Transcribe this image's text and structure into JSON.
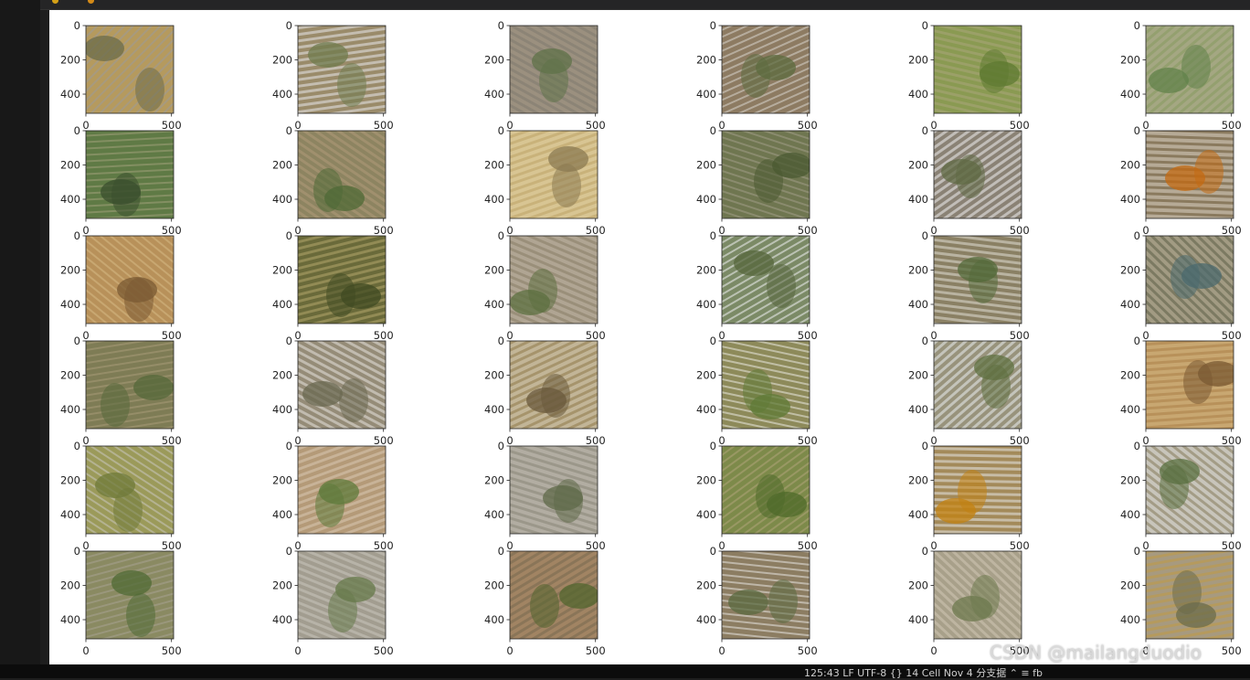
{
  "figure": {
    "rows": 6,
    "cols": 6,
    "tick_labels": {
      "y": [
        "0",
        "200",
        "400"
      ],
      "x": [
        "0",
        "500"
      ]
    },
    "panels": [
      {
        "theme": "house-yellow",
        "base": "#b59a5e",
        "accent": "#6b6b4a",
        "extra": "#9a9a9a"
      },
      {
        "theme": "rows-white",
        "base": "#9a8b6a",
        "accent": "#6f7b4e",
        "extra": "#e8e8ea"
      },
      {
        "theme": "mixed-field",
        "base": "#8c8476",
        "accent": "#5f7248",
        "extra": "#a79b86"
      },
      {
        "theme": "rows-brown",
        "base": "#8d7b62",
        "accent": "#5c6b3f",
        "extra": "#d9d5cd"
      },
      {
        "theme": "green-bush",
        "base": "#8a9a52",
        "accent": "#5e7a32",
        "extra": "#a9a67a"
      },
      {
        "theme": "green-field",
        "base": "#94a06f",
        "accent": "#61824a",
        "extra": "#b1ad92"
      },
      {
        "theme": "ravine",
        "base": "#5f7a45",
        "accent": "#3a4f2d",
        "extra": "#a0a07a"
      },
      {
        "theme": "terraces",
        "base": "#8d8461",
        "accent": "#4f6a36",
        "extra": "#b09a7a"
      },
      {
        "theme": "yellow-rows",
        "base": "#c9b27a",
        "accent": "#8b7a52",
        "extra": "#e3d6a8"
      },
      {
        "theme": "green-rows",
        "base": "#6f7650",
        "accent": "#4a5a32",
        "extra": "#a19d87"
      },
      {
        "theme": "white-rows",
        "base": "#8a8275",
        "accent": "#5f6a44",
        "extra": "#eeeeee"
      },
      {
        "theme": "orange-river",
        "base": "#8a7a5e",
        "accent": "#c36a12",
        "extra": "#dad2c4"
      },
      {
        "theme": "brown-terrace",
        "base": "#b8915a",
        "accent": "#7a5a33",
        "extra": "#d6b985"
      },
      {
        "theme": "dense-rows",
        "base": "#6a6a3a",
        "accent": "#3f4a22",
        "extra": "#b2a66c"
      },
      {
        "theme": "patchy",
        "base": "#9a8f7a",
        "accent": "#5c7040",
        "extra": "#c2b8a8"
      },
      {
        "theme": "white-diag",
        "base": "#7b8a66",
        "accent": "#56653c",
        "extra": "#f0f0f2"
      },
      {
        "theme": "rows-corner",
        "base": "#8a8064",
        "accent": "#536a3a",
        "extra": "#e0ddd4"
      },
      {
        "theme": "river-blue",
        "base": "#7c7a62",
        "accent": "#4b6a6e",
        "extra": "#c1b69e"
      },
      {
        "theme": "green-brown",
        "base": "#7e7c55",
        "accent": "#55683a",
        "extra": "#a89a78"
      },
      {
        "theme": "diag-rows",
        "base": "#958c78",
        "accent": "#6a6850",
        "extra": "#e6e2dc"
      },
      {
        "theme": "plots",
        "base": "#a6946c",
        "accent": "#6a5a3c",
        "extra": "#d8d0bc"
      },
      {
        "theme": "green-white",
        "base": "#8d8a5a",
        "accent": "#5f7a36",
        "extra": "#ebe9e2"
      },
      {
        "theme": "white-corner",
        "base": "#98937c",
        "accent": "#5f7040",
        "extra": "#e9ecef"
      },
      {
        "theme": "brown-terrace2",
        "base": "#b8915a",
        "accent": "#7a5a33",
        "extra": "#d6b985"
      },
      {
        "theme": "road",
        "base": "#9b9a5a",
        "accent": "#6f7a3a",
        "extra": "#c9c6bf"
      },
      {
        "theme": "brown-patches",
        "base": "#b49a78",
        "accent": "#5d7a3a",
        "extra": "#d8c9b2"
      },
      {
        "theme": "grey-terrace",
        "base": "#9b978a",
        "accent": "#5f6a48",
        "extra": "#c4c0b6"
      },
      {
        "theme": "green-crop",
        "base": "#7d8a4a",
        "accent": "#4f6a2a",
        "extra": "#b0a47a"
      },
      {
        "theme": "bridge",
        "base": "#a38a5a",
        "accent": "#c38212",
        "extra": "#e6e6e6"
      },
      {
        "theme": "strip-field",
        "base": "#a39c86",
        "accent": "#5a7040",
        "extra": "#e8e8e8"
      },
      {
        "theme": "green-slope",
        "base": "#8a8a62",
        "accent": "#4f6a34",
        "extra": "#a8a292"
      },
      {
        "theme": "grey-green",
        "base": "#a29d90",
        "accent": "#667a4a",
        "extra": "#c8c4bb"
      },
      {
        "theme": "blur-brown",
        "base": "#8a7558",
        "accent": "#52652e",
        "extra": "#b58f6e"
      },
      {
        "theme": "diag-white",
        "base": "#8c7d62",
        "accent": "#5a6a40",
        "extra": "#e8e6e2"
      },
      {
        "theme": "beige-plots",
        "base": "#a8a08a",
        "accent": "#6e7a4e",
        "extra": "#cfc7b5"
      },
      {
        "theme": "house-yellow2",
        "base": "#b59a5e",
        "accent": "#6b6b4a",
        "extra": "#9a9a9a"
      }
    ]
  },
  "statusbar": {
    "text": "125:43  LF  UTF-8  {} 14  Cell  Nov 4 分支据  ⌃  ≡  fb"
  },
  "watermark": "CSDN @mailangduodio"
}
